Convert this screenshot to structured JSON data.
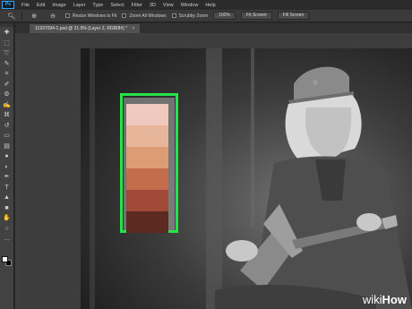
{
  "app": {
    "logo_text": "Ps"
  },
  "menu": [
    "File",
    "Edit",
    "Image",
    "Layer",
    "Type",
    "Select",
    "Filter",
    "3D",
    "View",
    "Window",
    "Help"
  ],
  "options_bar": {
    "checks": [
      "Resize Windows to Fit",
      "Zoom All Windows",
      "Scrubby Zoom"
    ],
    "buttons": [
      "100%",
      "Fit Screen",
      "Fill Screen"
    ]
  },
  "document": {
    "tab_title": "11937094-1.psd @ 21.9% (Layer 2, RGB/8#) *"
  },
  "palette": {
    "highlight_color": "#27e34a",
    "swatches": [
      "#efc9bd",
      "#e7b59a",
      "#dd9c73",
      "#c46d4c",
      "#a24a39",
      "#5d2a21"
    ]
  },
  "colors": {
    "foreground": "#ffffff",
    "background": "#000000"
  },
  "watermark": {
    "part1": "wiki",
    "part2": "How"
  }
}
